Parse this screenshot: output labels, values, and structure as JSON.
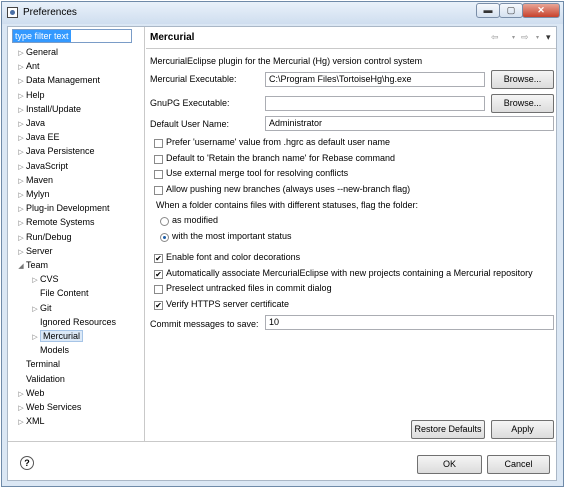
{
  "window": {
    "title": "Preferences"
  },
  "filter": {
    "value": "type filter text"
  },
  "tree": [
    {
      "label": "General",
      "arrow": "▷"
    },
    {
      "label": "Ant",
      "arrow": "▷"
    },
    {
      "label": "Data Management",
      "arrow": "▷"
    },
    {
      "label": "Help",
      "arrow": "▷"
    },
    {
      "label": "Install/Update",
      "arrow": "▷"
    },
    {
      "label": "Java",
      "arrow": "▷"
    },
    {
      "label": "Java EE",
      "arrow": "▷"
    },
    {
      "label": "Java Persistence",
      "arrow": "▷"
    },
    {
      "label": "JavaScript",
      "arrow": "▷"
    },
    {
      "label": "Maven",
      "arrow": "▷"
    },
    {
      "label": "Mylyn",
      "arrow": "▷"
    },
    {
      "label": "Plug-in Development",
      "arrow": "▷"
    },
    {
      "label": "Remote Systems",
      "arrow": "▷"
    },
    {
      "label": "Run/Debug",
      "arrow": "▷"
    },
    {
      "label": "Server",
      "arrow": "▷"
    },
    {
      "label": "Team",
      "arrow": "◢"
    },
    {
      "label": "CVS",
      "arrow": "▷"
    },
    {
      "label": "File Content",
      "arrow": ""
    },
    {
      "label": "Git",
      "arrow": "▷"
    },
    {
      "label": "Ignored Resources",
      "arrow": ""
    },
    {
      "label": "Mercurial",
      "arrow": "▷",
      "selected": true
    },
    {
      "label": "Models",
      "arrow": ""
    },
    {
      "label": "Terminal",
      "arrow": ""
    },
    {
      "label": "Validation",
      "arrow": ""
    },
    {
      "label": "Web",
      "arrow": "▷"
    },
    {
      "label": "Web Services",
      "arrow": "▷"
    },
    {
      "label": "XML",
      "arrow": "▷"
    }
  ],
  "page": {
    "title": "Mercurial",
    "nav_back": "⇦",
    "nav_forward": "⇨",
    "nav_menu": "▾",
    "description": "MercurialEclipse plugin for the Mercurial (Hg) version control system",
    "executable_label": "Mercurial Executable:",
    "executable_value": "C:\\Program Files\\TortoiseHg\\hg.exe",
    "gnupg_label": "GnuPG Executable:",
    "gnupg_value": "",
    "browse": "Browse...",
    "username_label": "Default User Name:",
    "username_value": "Administrator",
    "checks_top": [
      {
        "label": "Prefer 'username' value from .hgrc as default user name",
        "checked": false
      },
      {
        "label": "Default to 'Retain the branch name' for Rebase command",
        "checked": false
      },
      {
        "label": "Use external merge tool for resolving conflicts",
        "checked": false
      },
      {
        "label": "Allow pushing new branches (always uses --new-branch flag)",
        "checked": false
      }
    ],
    "folder_group_label": "When a folder contains files with different statuses, flag the folder:",
    "radios": [
      {
        "label": "as modified",
        "selected": false
      },
      {
        "label": "with the most important status",
        "selected": true
      }
    ],
    "checks_bottom": [
      {
        "label": "Enable font and color decorations",
        "checked": true
      },
      {
        "label": "Automatically associate MercurialEclipse with new projects containing a Mercurial repository",
        "checked": true
      },
      {
        "label": "Preselect untracked files in commit dialog",
        "checked": false
      },
      {
        "label": "Verify HTTPS server certificate",
        "checked": true
      }
    ],
    "commit_label": "Commit messages to save:",
    "commit_value": "10",
    "restore_defaults": "Restore Defaults",
    "apply": "Apply"
  },
  "footer": {
    "help": "?",
    "ok": "OK",
    "cancel": "Cancel"
  },
  "icons": {
    "check": "✔",
    "minimize": "▬",
    "maximize": "▢",
    "close": "✕"
  },
  "colors": {
    "selection": "#3399ff",
    "radio": "#1d5ea8"
  }
}
